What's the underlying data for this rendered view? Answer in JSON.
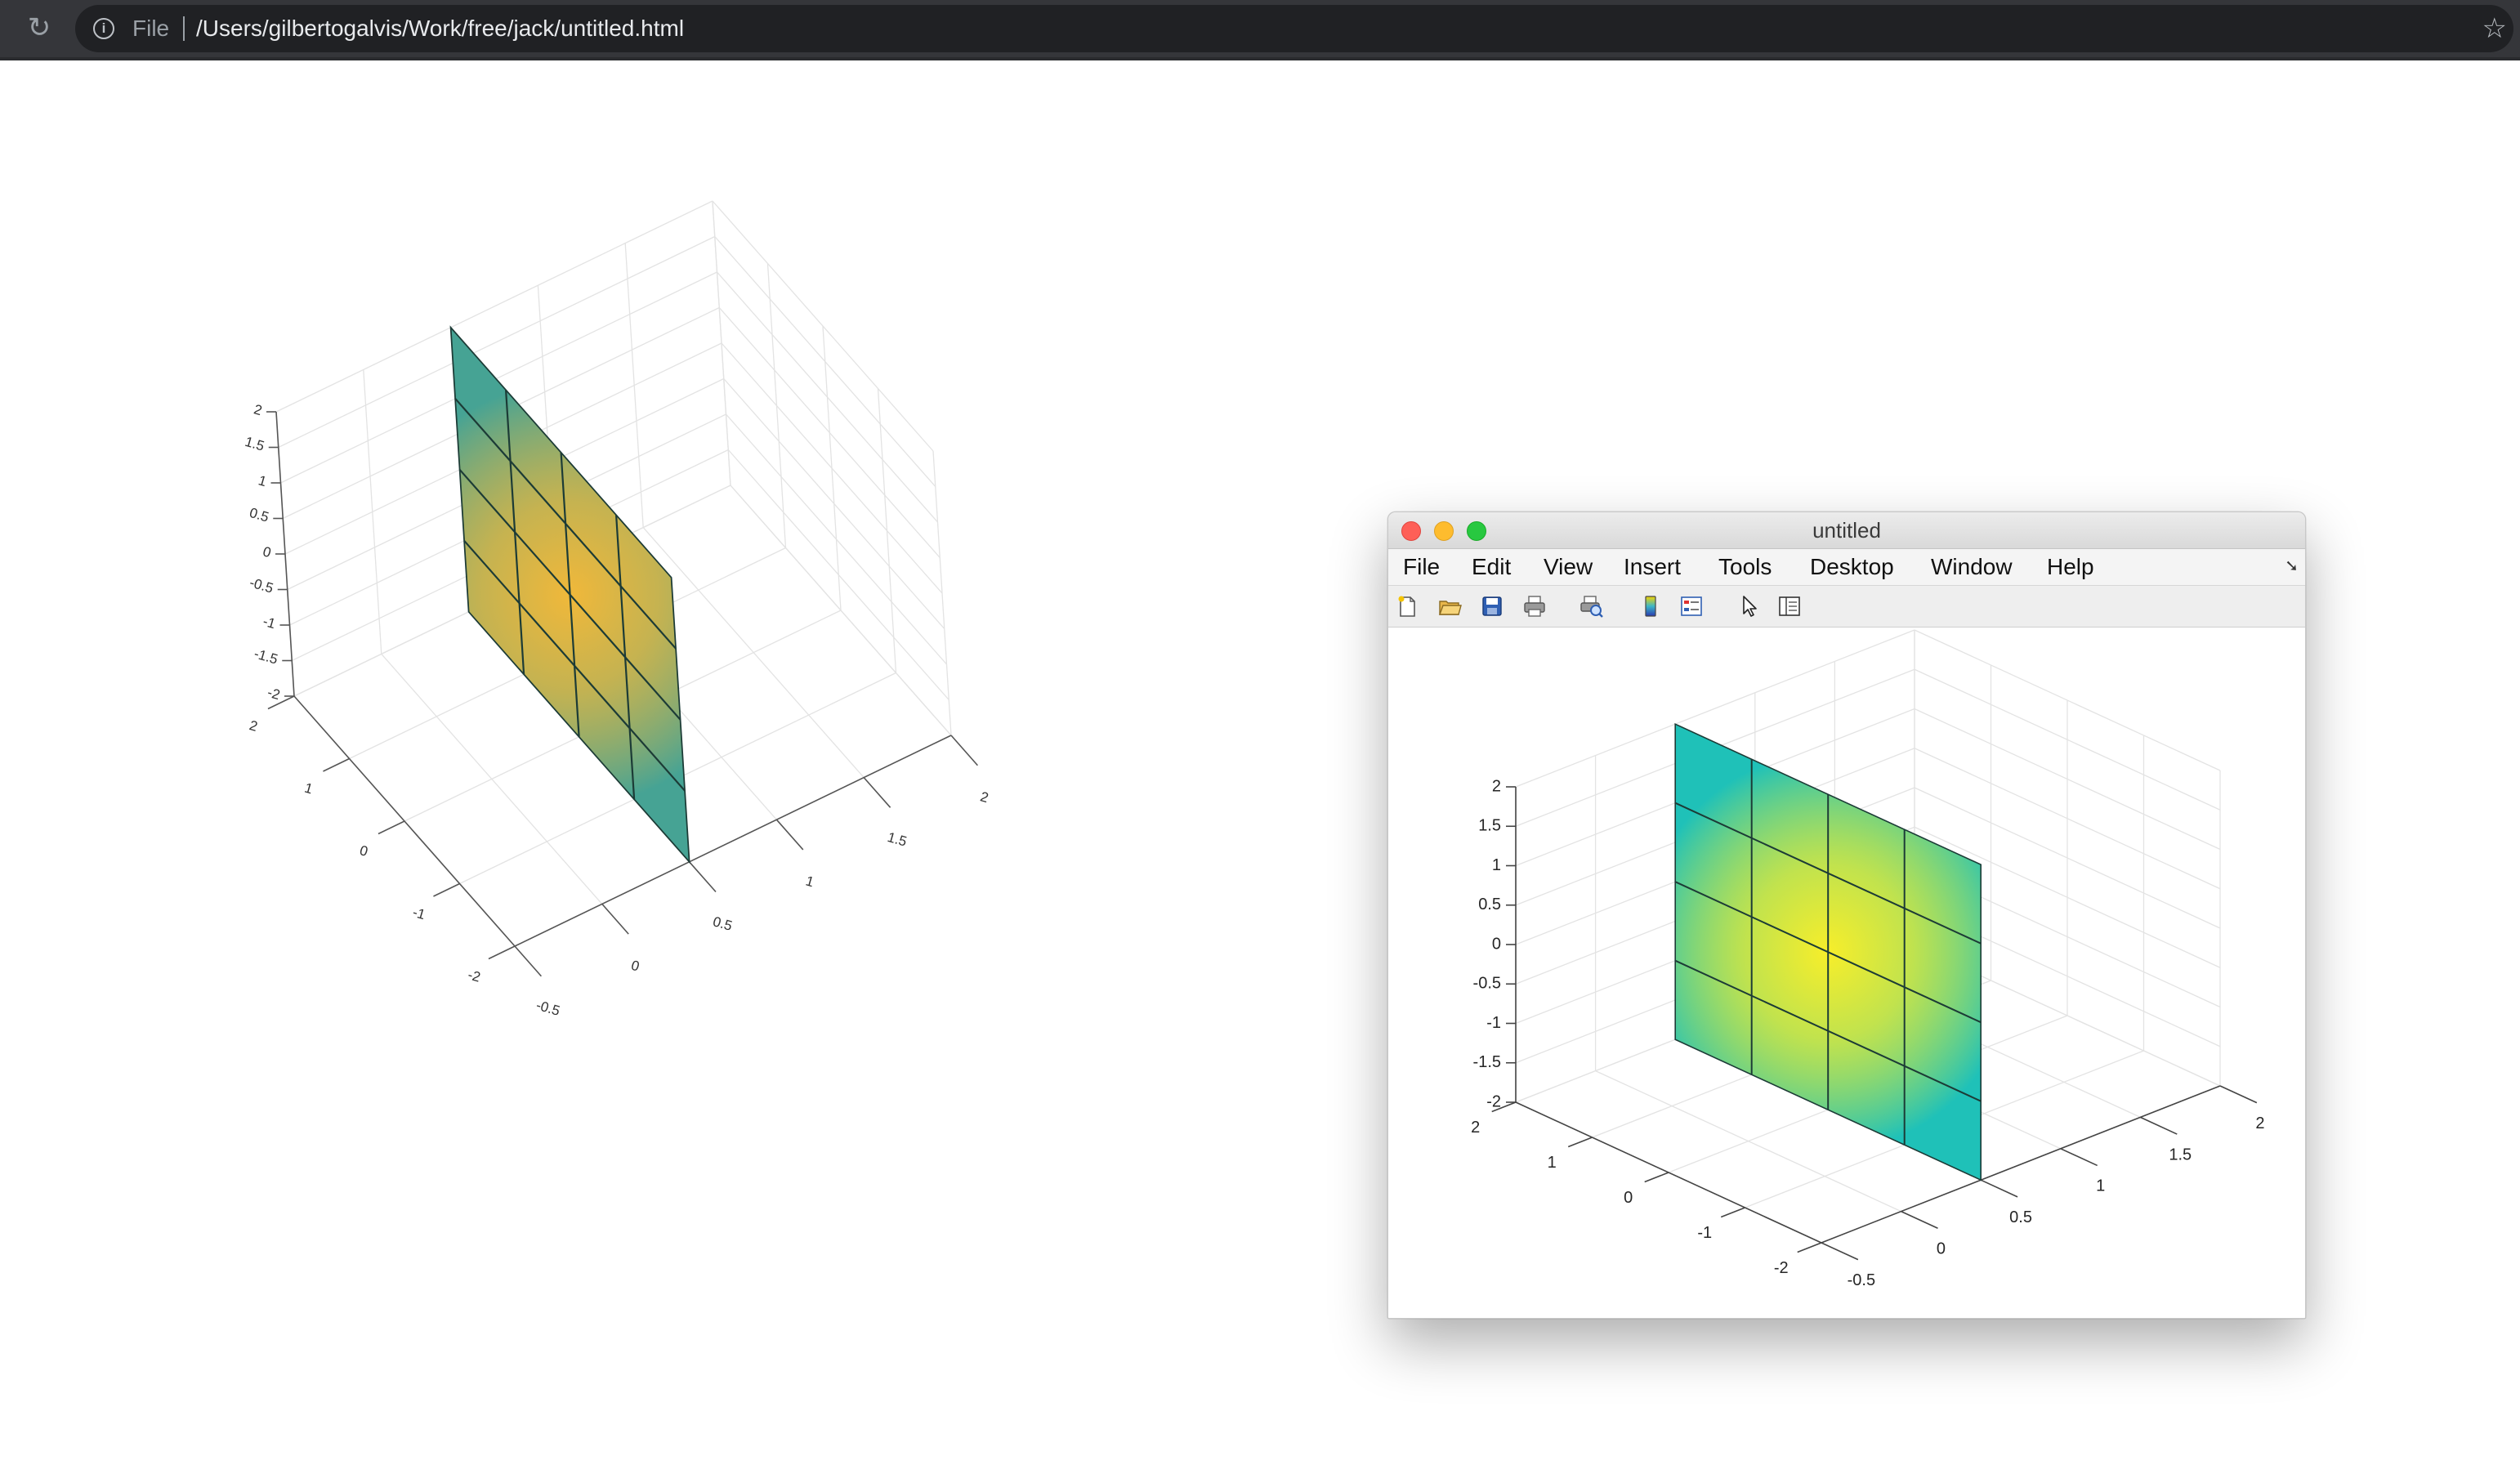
{
  "browser": {
    "url_scheme": "File",
    "url": "/Users/gilbertogalvis/Work/free/jack/untitled.html",
    "icons": [
      "reload-icon",
      "info-icon",
      "star-icon"
    ]
  },
  "window": {
    "title": "untitled",
    "menu": [
      "File",
      "Edit",
      "View",
      "Insert",
      "Tools",
      "Desktop",
      "Window",
      "Help"
    ],
    "toolbar_icons": [
      "new-figure-icon",
      "open-file-icon",
      "save-icon",
      "print-icon",
      "print-preview-icon",
      "colorbar-icon",
      "legend-icon",
      "pointer-icon",
      "property-editor-icon"
    ]
  },
  "chart_data": [
    {
      "type": "surface",
      "x_ticks": [
        "-0.5",
        "0",
        "0.5",
        "1",
        "1.5",
        "2"
      ],
      "y_ticks": [
        "-2",
        "-1",
        "0",
        "1",
        "2"
      ],
      "z_ticks": [
        "-2",
        "-1.5",
        "-1",
        "-0.5",
        "0",
        "0.5",
        "1",
        "1.5",
        "2"
      ],
      "xlim": [
        -0.5,
        2
      ],
      "ylim": [
        -2,
        2
      ],
      "zlim": [
        -2,
        2
      ],
      "plane_x": 0.5,
      "mesh_lines": 3,
      "grid": true,
      "colors": {
        "edge": "#46a394",
        "peak": "#f0b83a"
      }
    },
    {
      "type": "surface",
      "x_ticks": [
        "-0.5",
        "0",
        "0.5",
        "1",
        "1.5",
        "2"
      ],
      "y_ticks": [
        "-2",
        "-1",
        "0",
        "1",
        "2"
      ],
      "z_ticks": [
        "-2",
        "-1.5",
        "-1",
        "-0.5",
        "0",
        "0.5",
        "1",
        "1.5",
        "2"
      ],
      "xlim": [
        -0.5,
        2
      ],
      "ylim": [
        -2,
        2
      ],
      "zlim": [
        -2,
        2
      ],
      "plane_x": 0.5,
      "mesh_lines": 3,
      "grid": true,
      "colors": {
        "edge": "#1fc1b8",
        "peak": "#f7ee2a"
      }
    }
  ]
}
